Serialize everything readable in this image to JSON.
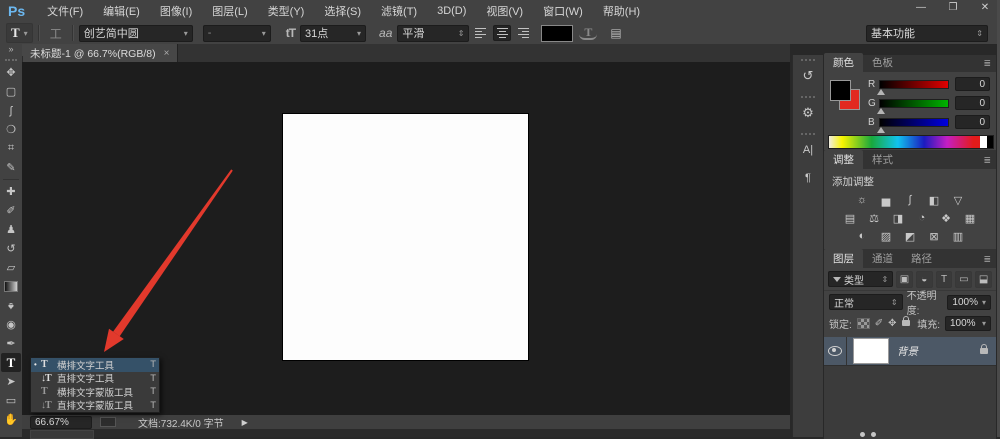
{
  "window": {
    "logo": "Ps",
    "minimize": "—",
    "restore": "❐",
    "close": "✕"
  },
  "menu": {
    "items": [
      "文件(F)",
      "编辑(E)",
      "图像(I)",
      "图层(L)",
      "类型(Y)",
      "选择(S)",
      "滤镜(T)",
      "3D(D)",
      "视图(V)",
      "窗口(W)",
      "帮助(H)"
    ]
  },
  "options": {
    "tool_icon": "T",
    "orientation_icon": "工",
    "font_family": "创艺简中圆",
    "font_style": "-",
    "size_icon": "tT",
    "font_size": "31点",
    "aa_icon": "aa",
    "anti_alias": "平滑",
    "color_hex": "#000000",
    "warp_icon": "T",
    "panels_icon": "▤",
    "workspace": "基本功能"
  },
  "tab": {
    "title": "未标题-1 @ 66.7%(RGB/8)",
    "close": "×"
  },
  "toolbar": {
    "collapse": "»",
    "tools": [
      {
        "name": "move",
        "glyph": "✥"
      },
      {
        "name": "rectangular-marquee",
        "glyph": "▢"
      },
      {
        "name": "lasso",
        "glyph": "ʃ"
      },
      {
        "name": "quick-selection",
        "glyph": "❍"
      },
      {
        "name": "crop",
        "glyph": "⌗"
      },
      {
        "name": "eyedropper",
        "glyph": "✎"
      },
      {
        "name": "spot-healing-brush",
        "glyph": "✚"
      },
      {
        "name": "brush",
        "glyph": "✐"
      },
      {
        "name": "clone-stamp",
        "glyph": "♟"
      },
      {
        "name": "history-brush",
        "glyph": "↺"
      },
      {
        "name": "eraser",
        "glyph": "▱"
      },
      {
        "name": "gradient",
        "glyph": ""
      },
      {
        "name": "blur",
        "glyph": "♠"
      },
      {
        "name": "dodge",
        "glyph": "◉"
      },
      {
        "name": "pen",
        "glyph": "✒"
      },
      {
        "name": "horizontal-type",
        "glyph": "T"
      },
      {
        "name": "path-selection",
        "glyph": "➤"
      },
      {
        "name": "rectangle",
        "glyph": "▭"
      },
      {
        "name": "hand",
        "glyph": "✋"
      }
    ]
  },
  "flyout": {
    "items": [
      {
        "marker": "•",
        "icon": "T",
        "label": "横排文字工具",
        "shortcut": "T"
      },
      {
        "marker": "",
        "icon": "↓T",
        "label": "直排文字工具",
        "shortcut": "T"
      },
      {
        "marker": "",
        "icon": "T",
        "label": "横排文字蒙版工具",
        "shortcut": "T"
      },
      {
        "marker": "",
        "icon": "↓T",
        "label": "直排文字蒙版工具",
        "shortcut": "T"
      }
    ]
  },
  "dock": {
    "history_icon": "↺",
    "properties_icon": "⚙",
    "character_icon": "A|",
    "paragraph_icon": "¶"
  },
  "color_panel": {
    "tab_color": "颜色",
    "tab_swatches": "色板",
    "menu_icon": "≣",
    "channels": [
      {
        "label": "R",
        "value": "0",
        "color": "#e00000"
      },
      {
        "label": "G",
        "value": "0",
        "color": "#00b400"
      },
      {
        "label": "B",
        "value": "0",
        "color": "#0000e0"
      }
    ]
  },
  "adjustments_panel": {
    "tab_adjustments": "调整",
    "tab_styles": "样式",
    "menu_icon": "≣",
    "title": "添加调整",
    "icons_row1": [
      "☼",
      "▅",
      "∫",
      "◧",
      "▽"
    ],
    "icons_row2": [
      "▤",
      "⚖",
      "◨",
      "◔",
      "❖",
      "▦"
    ],
    "icons_row3": [
      "◐",
      "▨",
      "◩",
      "⊠",
      "▥"
    ]
  },
  "layers_panel": {
    "tab_layers": "图层",
    "tab_channels": "通道",
    "tab_paths": "路径",
    "menu_icon": "≣",
    "filter_label": "类型",
    "filter_icons": [
      "▣",
      "◒",
      "T",
      "▭",
      "⬓"
    ],
    "blend_mode": "正常",
    "opacity_label": "不透明度:",
    "opacity_value": "100%",
    "lock_label": "锁定:",
    "fill_label": "填充:",
    "fill_value": "100%",
    "background_layer": "背景"
  },
  "status": {
    "zoom": "66.67%",
    "doc": "文档:732.4K/0 字节",
    "arrow": "▶"
  },
  "annotation": {
    "color": "#e2392c"
  },
  "colors": {
    "panel_bg": "#424242",
    "canvas_bg": "#1d1d1d",
    "selected_layer": "#4c5866",
    "flyout_selected": "#355168",
    "logo_blue": "#6cb8f0"
  }
}
